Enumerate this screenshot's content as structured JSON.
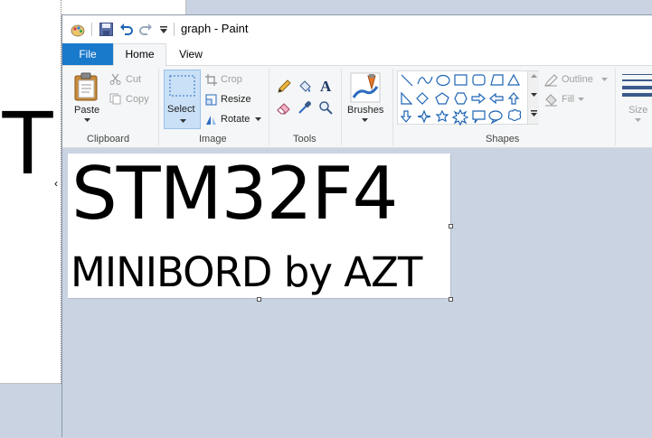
{
  "background_window": {
    "glyph": "T",
    "caret": "‹"
  },
  "window": {
    "title": "graph - Paint"
  },
  "tabs": {
    "file": "File",
    "home": "Home",
    "view": "View"
  },
  "clipboard": {
    "paste": "Paste",
    "cut": "Cut",
    "copy": "Copy",
    "group": "Clipboard"
  },
  "image": {
    "select": "Select",
    "crop": "Crop",
    "resize": "Resize",
    "rotate": "Rotate",
    "group": "Image"
  },
  "tools": {
    "group": "Tools"
  },
  "brushes": {
    "label": "Brushes"
  },
  "shapes": {
    "outline": "Outline",
    "fill": "Fill",
    "group": "Shapes"
  },
  "size": {
    "label": "Size"
  },
  "canvas": {
    "line1": "STM32F4",
    "line2": "MINIBORD by AZT"
  },
  "colors": {
    "accent": "#1979ca",
    "ribbon_bg": "#f5f6f7",
    "workspace_bg": "#c9d3e2",
    "shape_stroke": "#1e64b4"
  }
}
